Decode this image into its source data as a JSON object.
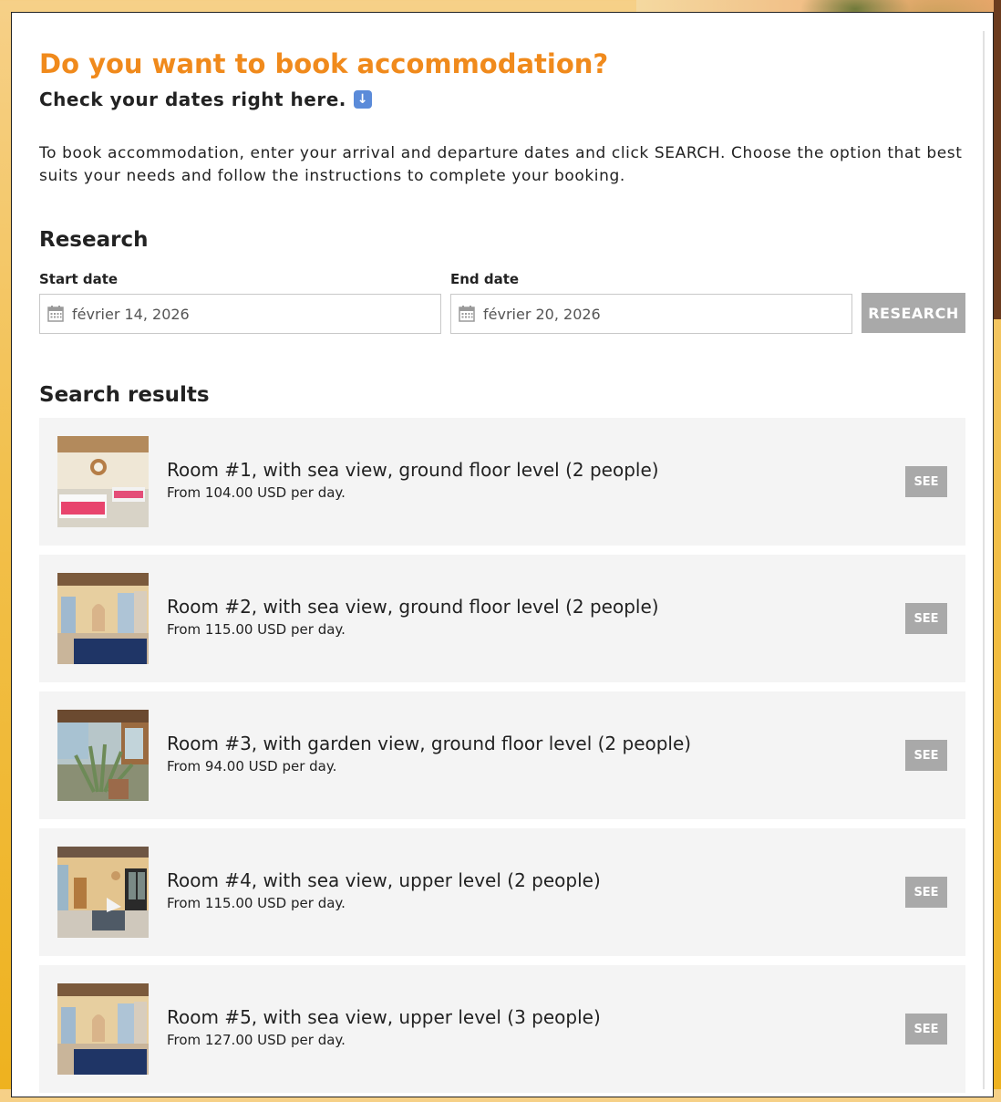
{
  "header": {
    "title": "Do you want to book accommodation?",
    "subtitle": "Check your dates right here.",
    "subtitle_icon": "down-arrow-emoji",
    "intro": "To book accommodation, enter your arrival and departure dates and click SEARCH. Choose the option that best suits your needs and follow the instructions to complete your booking."
  },
  "research": {
    "title": "Research",
    "start_label": "Start date",
    "start_value": "février 14, 2026",
    "end_label": "End date",
    "end_value": "février 20, 2026",
    "button_label": "RESEARCH"
  },
  "results": {
    "title": "Search results",
    "see_label": "SEE",
    "items": [
      {
        "name": "Room #1, with sea view, ground floor level (2 people)",
        "price": "From 104.00 USD per day."
      },
      {
        "name": "Room #2, with sea view, ground floor level (2 people)",
        "price": "From 115.00 USD per day."
      },
      {
        "name": "Room #3, with garden view, ground floor level (2 people)",
        "price": "From 94.00 USD per day."
      },
      {
        "name": "Room #4, with sea view, upper level (2 people)",
        "price": "From 115.00 USD per day."
      },
      {
        "name": "Room #5, with sea view, upper level (3 people)",
        "price": "From 127.00 USD per day."
      }
    ]
  },
  "colors": {
    "accent": "#f08a1c",
    "button_gray": "#a9a9a9",
    "card_bg": "#f4f4f4"
  }
}
